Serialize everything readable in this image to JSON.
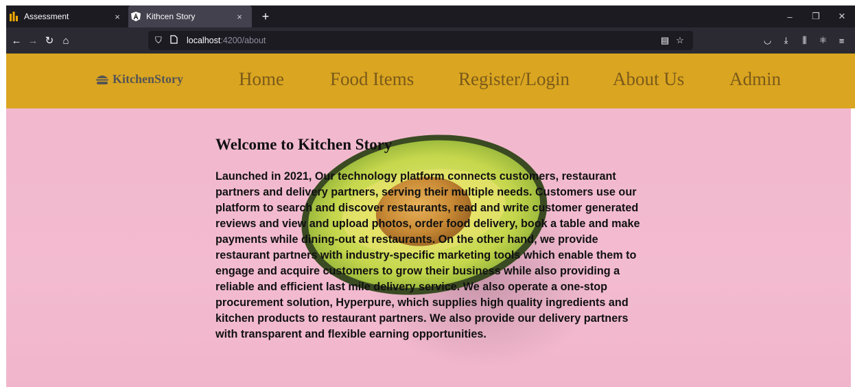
{
  "browser": {
    "tabs": [
      {
        "title": "Assessment",
        "close": "×",
        "active": false
      },
      {
        "title": "Kithcen Story",
        "close": "×",
        "active": true
      }
    ],
    "new_tab": "+",
    "window_controls": {
      "minimize": "–",
      "restore": "❐",
      "close": "✕"
    },
    "url": {
      "host": "localhost",
      "path": ":4200/about"
    }
  },
  "site": {
    "brand": "KitchenStory",
    "nav": [
      "Home",
      "Food Items",
      "Register/Login",
      "About Us",
      "Admin"
    ]
  },
  "about": {
    "title": "Welcome to Kitchen Story",
    "body": "Launched in 2021, Our technology platform connects customers, restaurant partners and delivery partners, serving their multiple needs. Customers use our platform to search and discover restaurants, read and write customer generated reviews and view and upload photos, order food delivery, book a table and make payments while dining-out at restaurants. On the other hand, we provide restaurant partners with industry-specific marketing tools which enable them to engage and acquire customers to grow their business while also providing a reliable and efficient last mile delivery service. We also operate a one-stop procurement solution, Hyperpure, which supplies high quality ingredients and kitchen products to restaurant partners. We also provide our delivery partners with transparent and flexible earning opportunities."
  },
  "colors": {
    "navbar": "#daa520",
    "hero_bg": "#f3bbd0",
    "chrome_dark": "#1c1b22"
  }
}
